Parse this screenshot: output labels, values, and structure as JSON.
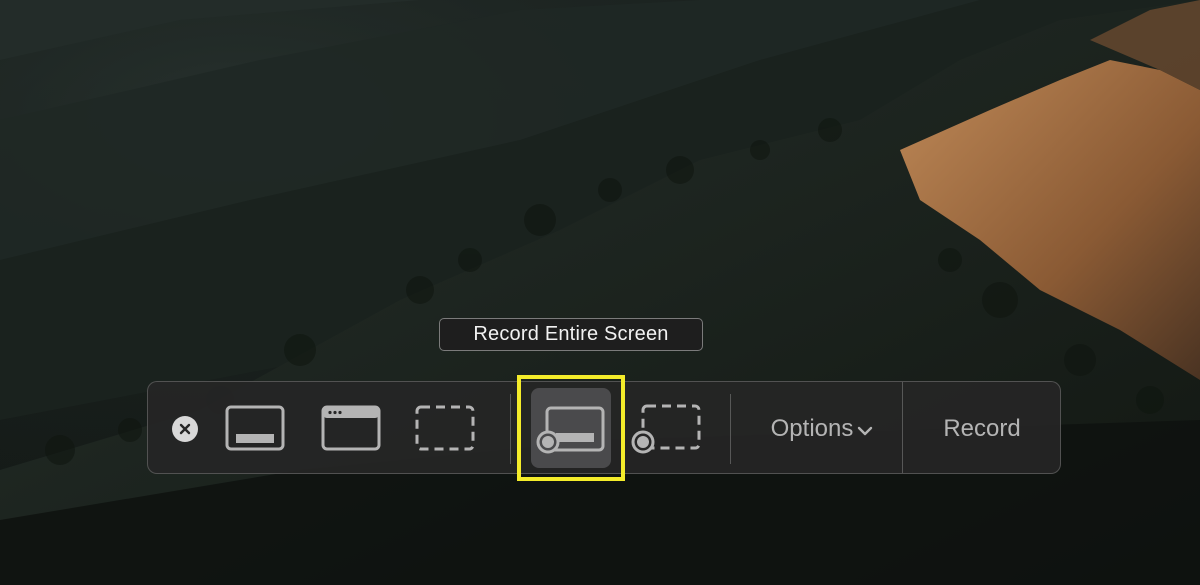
{
  "tooltip": {
    "text": "Record Entire Screen"
  },
  "toolbar": {
    "tools": [
      {
        "name": "close",
        "icon": "close-icon"
      },
      {
        "name": "capture-entire-screen",
        "icon": "screen-capture-icon"
      },
      {
        "name": "capture-selected-window",
        "icon": "window-capture-icon"
      },
      {
        "name": "capture-selected-portion",
        "icon": "portion-capture-icon"
      },
      {
        "name": "record-entire-screen",
        "icon": "screen-record-icon",
        "selected": true
      },
      {
        "name": "record-selected-portion",
        "icon": "portion-record-icon"
      }
    ],
    "options_label": "Options",
    "record_label": "Record"
  },
  "colors": {
    "toolbar_bg": "#262626",
    "icon": "#b4b4b4",
    "selected_bg": "#4a4a4c",
    "highlight": "#f4ec2a"
  }
}
